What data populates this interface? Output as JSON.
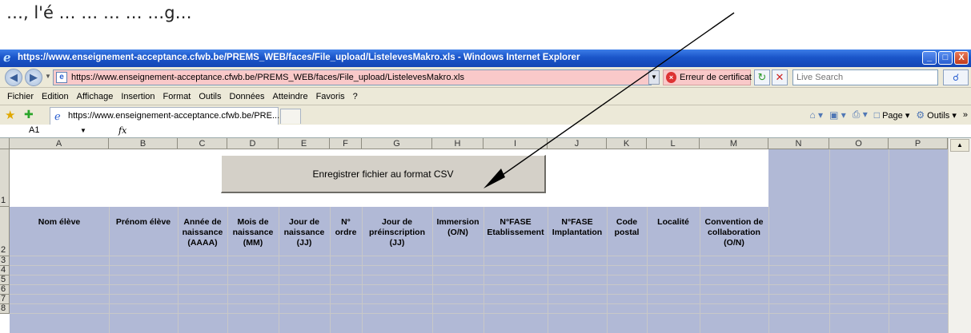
{
  "caption": {
    "text": "…, l'é     …     …  …    …   …g…"
  },
  "window": {
    "title": "https://www.enseignement-acceptance.cfwb.be/PREMS_WEB/faces/File_upload/ListelevesMakro.xls - Windows Internet Explorer",
    "min": "_",
    "max": "□",
    "close": "X"
  },
  "address": {
    "url": "https://www.enseignement-acceptance.cfwb.be/PREMS_WEB/faces/File_upload/ListelevesMakro.xls",
    "cert_error": "Erreur de certificat",
    "search_placeholder": "Live Search"
  },
  "menu": [
    "Fichier",
    "Edition",
    "Affichage",
    "Insertion",
    "Format",
    "Outils",
    "Données",
    "Atteindre",
    "Favoris",
    "?"
  ],
  "tab": {
    "title": "https://www.enseignement-acceptance.cfwb.be/PRE..."
  },
  "commands": {
    "page": "Page",
    "tools": "Outils"
  },
  "formula": {
    "cell": "A1",
    "fx": "fx"
  },
  "columns": [
    "A",
    "B",
    "C",
    "D",
    "E",
    "F",
    "G",
    "H",
    "I",
    "J",
    "K",
    "L",
    "M",
    "N",
    "O",
    "P"
  ],
  "rows": [
    "1",
    "2",
    "3",
    "4",
    "5",
    "6",
    "7",
    "8"
  ],
  "button": {
    "label": "Enregistrer fichier au format CSV"
  },
  "headers": [
    "Nom élève",
    "Prénom élève",
    "Année de naissance (AAAA)",
    "Mois de naissance (MM)",
    "Jour de naissance (JJ)",
    "N° ordre",
    "Jour de préinscription (JJ)",
    "Immersion (O/N)",
    "N°FASE Etablissement",
    "N°FASE Implantation",
    "Code postal",
    "Localité",
    "Convention de collaboration (O/N)"
  ],
  "colors": {
    "blue_cells": "#b1b9d6",
    "title_bar": "#1a55c9",
    "url_error_bg": "#f9c9c9"
  }
}
